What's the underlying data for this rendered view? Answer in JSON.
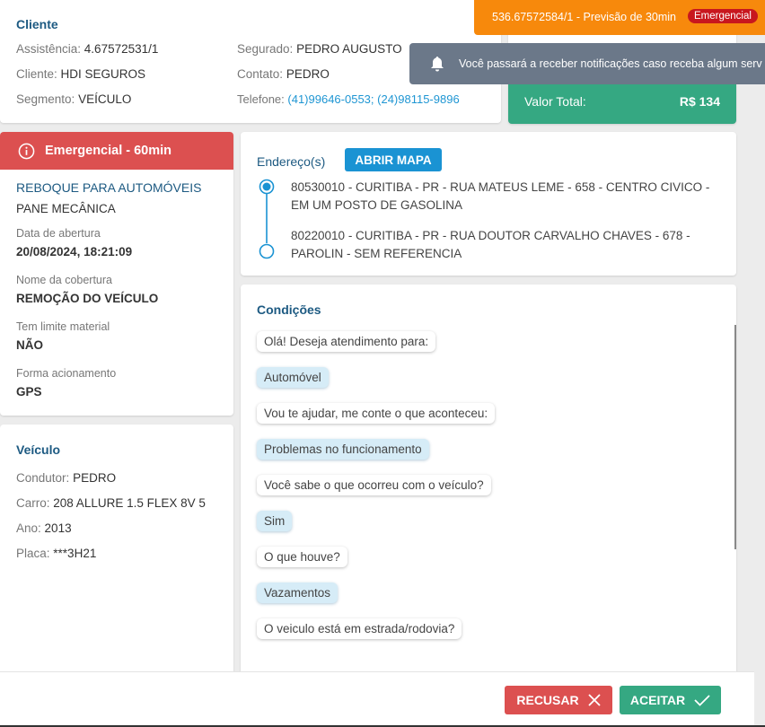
{
  "cliente": {
    "title": "Cliente",
    "assistencia_label": "Assistência:",
    "assistencia": "4.67572531/1",
    "cliente_label": "Cliente:",
    "cliente": "HDI SEGUROS",
    "segmento_label": "Segmento:",
    "segmento": "VEÍCULO",
    "segurado_label": "Segurado:",
    "segurado": "PEDRO AUGUSTO",
    "contato_label": "Contato:",
    "contato": "PEDRO",
    "telefone_label": "Telefone:",
    "telefone": "(41)99646-0553; (24)98115-9896"
  },
  "banner": {
    "text": "536.67572584/1 - Previsão de 30min",
    "badge": "Emergencial",
    "color": "#f7890c"
  },
  "toast": {
    "text": "Você passará a receber notificações caso receba algum serv",
    "icon": "bell-icon"
  },
  "valor": {
    "label": "Valor Total:",
    "value": "R$ 134",
    "color": "#35a882"
  },
  "servico": {
    "header": "Emergencial - 60min",
    "header_color": "#dc5050",
    "tipo": "REBOQUE PARA AUTOMÓVEIS",
    "problema": "PANE MECÂNICA",
    "data_label": "Data de abertura",
    "data": "20/08/2024, 18:21:09",
    "cobertura_label": "Nome da cobertura",
    "cobertura": "REMOÇÃO DO VEÍCULO",
    "limite_label": "Tem limite material",
    "limite": "NÃO",
    "acionamento_label": "Forma acionamento",
    "acionamento": "GPS"
  },
  "veiculo": {
    "title": "Veículo",
    "condutor_label": "Condutor:",
    "condutor": "PEDRO",
    "carro_label": "Carro:",
    "carro": "208 ALLURE 1.5 FLEX 8V 5",
    "ano_label": "Ano:",
    "ano": "2013",
    "placa_label": "Placa:",
    "placa": "***3H21"
  },
  "enderecos": {
    "title": "Endereço(s)",
    "map_button": "ABRIR MAPA",
    "items": [
      "80530010 - CURITIBA - PR - RUA MATEUS LEME - 658 - CENTRO CIVICO - EM UM POSTO DE GASOLINA",
      "80220010 - CURITIBA - PR - RUA DOUTOR CARVALHO CHAVES - 678 - PAROLIN - SEM REFERENCIA"
    ]
  },
  "condicoes": {
    "title": "Condições",
    "messages": [
      {
        "text": "Olá! Deseja atendimento para:",
        "answer": false
      },
      {
        "text": "Automóvel",
        "answer": true
      },
      {
        "text": "Vou te ajudar, me conte o que aconteceu:",
        "answer": false
      },
      {
        "text": "Problemas no funcionamento",
        "answer": true
      },
      {
        "text": "Você sabe o que ocorreu com o veículo?",
        "answer": false
      },
      {
        "text": "Sim",
        "answer": true
      },
      {
        "text": "O que houve?",
        "answer": false
      },
      {
        "text": "Vazamentos",
        "answer": true
      },
      {
        "text": "O veiculo está em estrada/rodovia?",
        "answer": false
      }
    ]
  },
  "footer": {
    "recusar": "RECUSAR",
    "aceitar": "ACEITAR"
  }
}
